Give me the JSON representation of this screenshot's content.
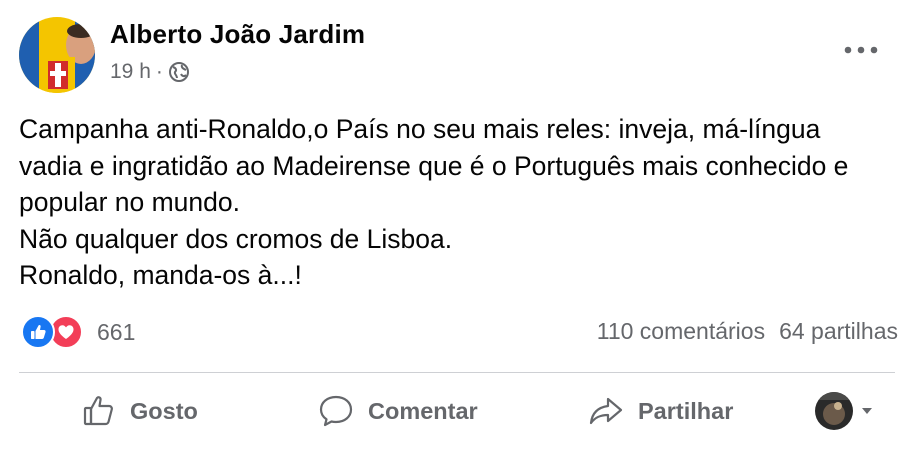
{
  "post": {
    "author": "Alberto João Jardim",
    "time": "19 h",
    "separator": "·",
    "privacy_icon": "globe-icon",
    "more_icon": "more-options-icon",
    "text_lines": [
      "Campanha anti-Ronaldo,o País no seu mais reles: inveja, má-língua",
      "vadia e ingratidão ao Madeirense que é o Português mais conhecido e",
      "popular no mundo.",
      "Não qualquer dos cromos de Lisboa.",
      "Ronaldo, manda-os à...!"
    ]
  },
  "reactions": {
    "icons": [
      "like-reaction-icon",
      "love-reaction-icon"
    ],
    "count": "661",
    "comments": "110 comentários",
    "shares": "64 partilhas"
  },
  "actions": {
    "like": "Gosto",
    "comment": "Comentar",
    "share": "Partilhar"
  },
  "colors": {
    "text": "#050505",
    "secondary": "#65676b",
    "like_blue": "#1877f2",
    "love_red": "#f33e58",
    "divider": "#ced0d4"
  }
}
